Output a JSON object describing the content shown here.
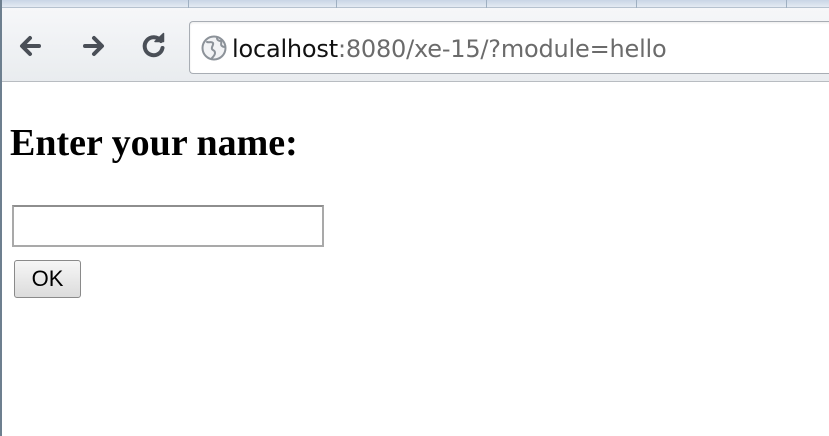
{
  "browser": {
    "address_bar": {
      "host": "localhost",
      "rest": ":8080/xe-15/?module=hello"
    },
    "buttons": {
      "back_icon": "back-arrow-icon",
      "forward_icon": "forward-arrow-icon",
      "reload_icon": "reload-icon",
      "site_icon": "globe-icon"
    }
  },
  "page": {
    "heading": "Enter your name:",
    "name_input_value": "",
    "ok_label": "OK"
  }
}
